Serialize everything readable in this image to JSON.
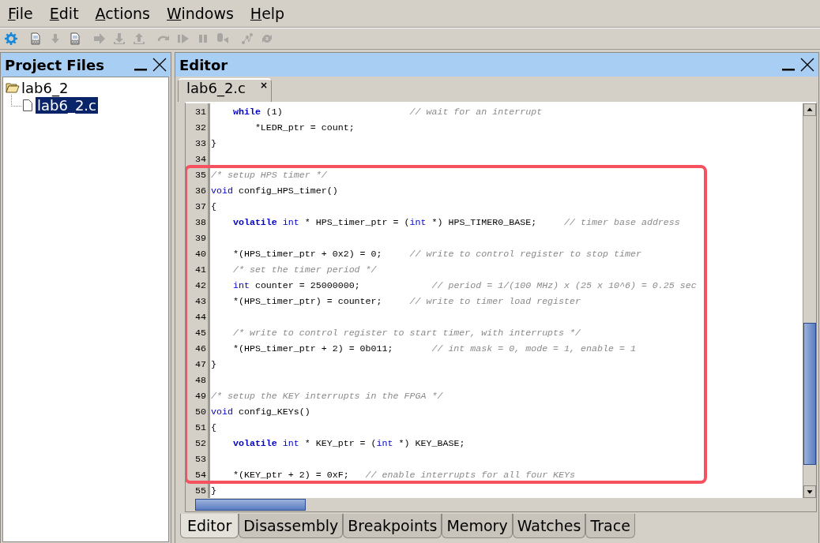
{
  "menu": [
    {
      "label": "File"
    },
    {
      "label": "Edit"
    },
    {
      "label": "Actions"
    },
    {
      "label": "Windows"
    },
    {
      "label": "Help"
    }
  ],
  "toolbar": [
    {
      "kind": "gear",
      "disabled": false
    },
    {
      "kind": "binary-doc",
      "disabled": false
    },
    {
      "kind": "down-arrow",
      "disabled": true
    },
    {
      "kind": "binary-doc",
      "disabled": false
    },
    {
      "kind": "right-arrow",
      "disabled": true
    },
    {
      "kind": "download",
      "disabled": true
    },
    {
      "kind": "upload",
      "disabled": true
    },
    {
      "kind": "redo",
      "disabled": true
    },
    {
      "kind": "play",
      "disabled": true
    },
    {
      "kind": "pause",
      "disabled": true
    },
    {
      "kind": "step",
      "disabled": true
    },
    {
      "kind": "graph",
      "disabled": true
    },
    {
      "kind": "sync",
      "disabled": true
    }
  ],
  "project_panel": {
    "title": "Project Files",
    "tree": [
      {
        "label": "lab6_2",
        "expanded": true,
        "selected": false,
        "children": [
          {
            "label": "lab6_2.c",
            "selected": true
          }
        ]
      }
    ]
  },
  "editor_panel": {
    "title": "Editor",
    "file_tabs": [
      {
        "label": "lab6_2.c",
        "close": "×",
        "selected": true
      }
    ],
    "blocks": [
      {
        "highlighted": false,
        "lines": [
          {
            "number": "31",
            "tokens": [
              {
                "kind": "keyword",
                "text": "    while"
              },
              {
                "kind": "code",
                "text": " (1)                       "
              },
              {
                "kind": "comment",
                "text": "// wait for an interrupt"
              }
            ]
          },
          {
            "number": "32",
            "tokens": [
              {
                "kind": "code",
                "text": "        *LEDR_ptr = count;"
              }
            ]
          },
          {
            "number": "33",
            "tokens": [
              {
                "kind": "code",
                "text": "}"
              }
            ]
          },
          {
            "number": "34"
          }
        ]
      },
      {
        "highlighted": true,
        "lines": [
          {
            "number": "35",
            "tokens": [
              {
                "kind": "comment",
                "text": "/* setup HPS timer */"
              }
            ]
          },
          {
            "number": "36",
            "tokens": [
              {
                "kind": "type",
                "text": "void"
              },
              {
                "kind": "code",
                "text": " config_HPS_timer()"
              }
            ]
          },
          {
            "number": "37",
            "tokens": [
              {
                "kind": "code",
                "text": "{"
              }
            ]
          },
          {
            "number": "38",
            "tokens": [
              {
                "kind": "keyword",
                "text": "    volatile"
              },
              {
                "kind": "type",
                "text": " int"
              },
              {
                "kind": "code",
                "text": " * HPS_timer_ptr = ("
              },
              {
                "kind": "type",
                "text": "int"
              },
              {
                "kind": "code",
                "text": " *) HPS_TIMER0_BASE;     "
              },
              {
                "kind": "comment",
                "text": "// timer base address"
              }
            ]
          },
          {
            "number": "39"
          },
          {
            "number": "40",
            "tokens": [
              {
                "kind": "code",
                "text": "    *(HPS_timer_ptr + 0x2) = 0;     "
              },
              {
                "kind": "comment",
                "text": "// write to control register to stop timer"
              }
            ]
          },
          {
            "number": "41",
            "tokens": [
              {
                "kind": "comment",
                "text": "    /* set the timer period */"
              }
            ]
          },
          {
            "number": "42",
            "tokens": [
              {
                "kind": "type",
                "text": "    int"
              },
              {
                "kind": "code",
                "text": " counter = 25000000;             "
              },
              {
                "kind": "comment",
                "text": "// period = 1/(100 MHz) x (25 x 10^6) = 0.25 sec"
              }
            ]
          },
          {
            "number": "43",
            "tokens": [
              {
                "kind": "code",
                "text": "    *(HPS_timer_ptr) = counter;     "
              },
              {
                "kind": "comment",
                "text": "// write to timer load register"
              }
            ]
          },
          {
            "number": "44"
          },
          {
            "number": "45",
            "tokens": [
              {
                "kind": "comment",
                "text": "    /* write to control register to start timer, with interrupts */"
              }
            ]
          },
          {
            "number": "46",
            "tokens": [
              {
                "kind": "code",
                "text": "    *(HPS_timer_ptr + 2) = 0b011;       "
              },
              {
                "kind": "comment",
                "text": "// int mask = 0, mode = 1, enable = 1"
              }
            ]
          },
          {
            "number": "47",
            "tokens": [
              {
                "kind": "code",
                "text": "}"
              }
            ]
          },
          {
            "number": "48"
          },
          {
            "number": "49",
            "tokens": [
              {
                "kind": "comment",
                "text": "/* setup the KEY interrupts in the FPGA */"
              }
            ]
          },
          {
            "number": "50",
            "tokens": [
              {
                "kind": "type",
                "text": "void"
              },
              {
                "kind": "code",
                "text": " config_KEYs()"
              }
            ]
          },
          {
            "number": "51",
            "tokens": [
              {
                "kind": "code",
                "text": "{"
              }
            ]
          },
          {
            "number": "52",
            "tokens": [
              {
                "kind": "keyword",
                "text": "    volatile"
              },
              {
                "kind": "type",
                "text": " int"
              },
              {
                "kind": "code",
                "text": " * KEY_ptr = ("
              },
              {
                "kind": "type",
                "text": "int"
              },
              {
                "kind": "code",
                "text": " *) KEY_BASE;"
              }
            ]
          },
          {
            "number": "53"
          },
          {
            "number": "54",
            "tokens": [
              {
                "kind": "code",
                "text": "    *(KEY_ptr + 2) = 0xF;   "
              },
              {
                "kind": "comment",
                "text": "// enable interrupts for all four KEYs"
              }
            ]
          }
        ]
      },
      {
        "highlighted": false,
        "lines": [
          {
            "number": "55",
            "tokens": [
              {
                "kind": "code",
                "text": "}"
              }
            ]
          }
        ]
      }
    ],
    "view_tabs": [
      {
        "label": "Editor",
        "selected": true
      },
      {
        "label": "Disassembly",
        "selected": false
      },
      {
        "label": "Breakpoints",
        "selected": false
      },
      {
        "label": "Memory",
        "selected": false
      },
      {
        "label": "Watches",
        "selected": false
      },
      {
        "label": "Trace",
        "selected": false
      }
    ]
  }
}
